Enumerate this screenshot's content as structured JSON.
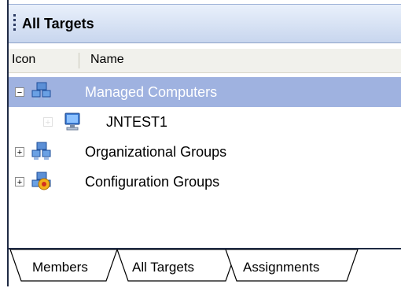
{
  "panel": {
    "title": "All Targets"
  },
  "columns": {
    "icon": "Icon",
    "name": "Name"
  },
  "tree": [
    {
      "label": "Managed Computers",
      "expander": "−",
      "icon": "computer-group-icon",
      "selected": true
    },
    {
      "label": "JNTEST1",
      "expander": "+",
      "icon": "monitor-icon"
    },
    {
      "label": "Organizational Groups",
      "expander": "+",
      "icon": "computer-group-icon"
    },
    {
      "label": "Configuration Groups",
      "expander": "+",
      "icon": "configuration-group-icon"
    }
  ],
  "tabs": [
    {
      "label": "Members"
    },
    {
      "label": "All Targets",
      "active": true
    },
    {
      "label": "Assignments"
    }
  ],
  "colors": {
    "selection": "#9fb2e0",
    "selected_text": "#ffffff",
    "frame": "#1f2a44"
  }
}
